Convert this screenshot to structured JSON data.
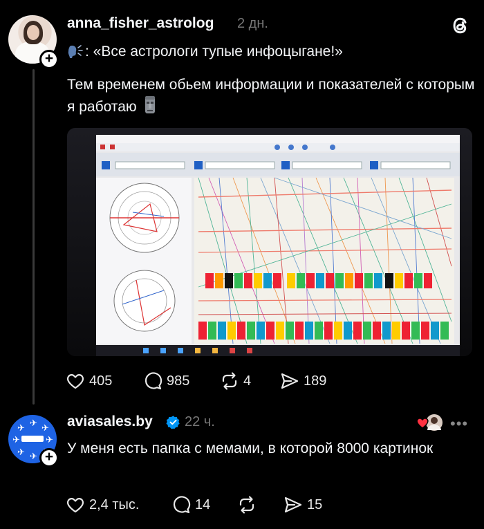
{
  "post": {
    "username": "anna_fisher_astrolog",
    "time": "2 дн.",
    "quote_text": ": «Все астрологи тупые инфоцыгане!»",
    "body_text": "Тем временем обьем информации и показателей с которым я работаю",
    "actions": {
      "likes": "405",
      "comments": "985",
      "reposts": "4",
      "shares": "189"
    }
  },
  "reply": {
    "username": "aviasales.by",
    "time": "22 ч.",
    "body_text": "У меня есть папка с мемами, в которой 8000 картинок",
    "actions": {
      "likes": "2,4 тыс.",
      "comments": "14",
      "shares": "15"
    }
  },
  "icons": {
    "like": "heart-icon",
    "comment": "comment-bubble-icon",
    "repost": "repost-icon",
    "share": "send-icon",
    "brand": "threads-logo-icon"
  },
  "colors": {
    "background": "#000000",
    "text": "#f3f5f7",
    "muted": "#777777",
    "verified": "#0095f6",
    "avatar_brand": "#1e63e4"
  }
}
